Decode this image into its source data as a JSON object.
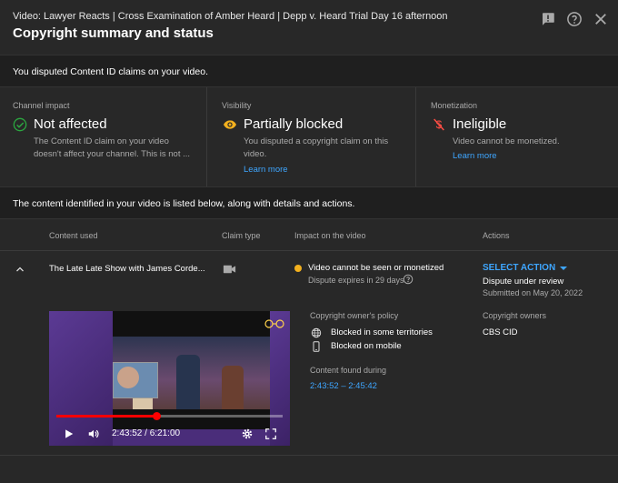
{
  "header": {
    "video_title": "Video: Lawyer Reacts | Cross Examination of Amber Heard | Depp v. Heard Trial Day 16 afternoon",
    "page_title": "Copyright summary and status",
    "icons": [
      "feedback-icon",
      "help-icon",
      "close-icon"
    ]
  },
  "notice": {
    "text": "You disputed Content ID claims on your video."
  },
  "impact": {
    "channel": {
      "label": "Channel impact",
      "status": "Not affected",
      "description": "The Content ID claim on your video doesn't affect your channel. This is not ...",
      "icon": "check-circle-icon",
      "color": "#2ba640"
    },
    "visibility": {
      "label": "Visibility",
      "status": "Partially blocked",
      "description": "You disputed a copyright claim on this video.",
      "link": "Learn more",
      "icon": "eye-icon",
      "color": "#f2b01e"
    },
    "monetization": {
      "label": "Monetization",
      "status": "Ineligible",
      "description": "Video cannot be monetized.",
      "link": "Learn more",
      "icon": "no-money-icon",
      "color": "#ff4e45"
    }
  },
  "content_notice": {
    "text": "The content identified in your video is listed below, along with details and actions."
  },
  "table": {
    "headers": [
      "Content used",
      "Claim type",
      "Impact on the video",
      "Actions"
    ],
    "rows": [
      {
        "content_used": "The Late Late Show with James Corde...",
        "claim_type_icon": "video-camera-icon",
        "impact": "Video cannot be seen or monetized",
        "dispute_expires": "Dispute expires in 29 days",
        "action_label": "SELECT ACTION",
        "action_status": "Dispute under review",
        "submitted": "Submitted on May 20, 2022",
        "status_color": "#f2b01e"
      }
    ]
  },
  "details": {
    "policy_label": "Copyright owner's policy",
    "policy_items": [
      {
        "icon": "globe-icon",
        "text": "Blocked in some territories"
      },
      {
        "icon": "mobile-icon",
        "text": "Blocked on mobile"
      }
    ],
    "found_label": "Content found during",
    "found_range": "2:43:52 – 2:45:42",
    "owners_label": "Copyright owners",
    "owner": "CBS CID"
  },
  "player": {
    "time": "2:43:52 / 6:21:00",
    "progress": 0.44
  }
}
